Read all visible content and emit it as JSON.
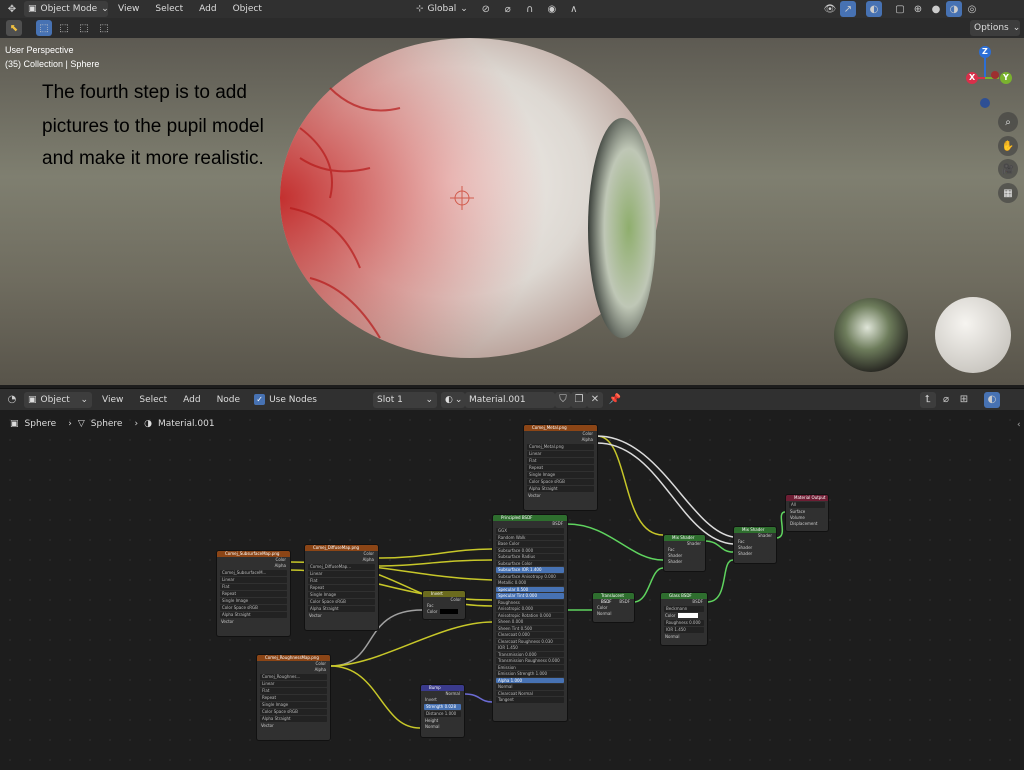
{
  "top_header": {
    "mode": "Object Mode",
    "menus": [
      "View",
      "Select",
      "Add",
      "Object"
    ],
    "orientation": "Global",
    "options_label": "Options"
  },
  "viewport": {
    "perspective": "User Perspective",
    "collection": "(35) Collection | Sphere",
    "annotation": [
      "The fourth step is to add",
      "pictures to the pupil model",
      "and make it more realistic."
    ],
    "gizmo": {
      "z": "Z",
      "x": "X",
      "y": "Y"
    }
  },
  "node_header": {
    "object": "Object",
    "menus": [
      "View",
      "Select",
      "Add",
      "Node"
    ],
    "use_nodes_label": "Use Nodes",
    "use_nodes_checked": true,
    "slot": "Slot 1",
    "material": "Material.001"
  },
  "breadcrumb": {
    "items": [
      "Sphere",
      "Sphere",
      "Material.001"
    ]
  },
  "nodes": {
    "tex_metal": {
      "title": "Comej_Metal.png",
      "outputs": [
        "Color",
        "Alpha"
      ],
      "image": "Comej_Metal.png",
      "rows": [
        "Linear",
        "Flat",
        "Repeat",
        "Single Image",
        "Color Space   sRGB",
        "Alpha   Straight"
      ],
      "inputs": [
        "Vector"
      ]
    },
    "tex_subsurface": {
      "title": "Comej_SubsurfaceMap.png",
      "outputs": [
        "Color",
        "Alpha"
      ],
      "image": "Comej_SubsurfaceM...",
      "rows": [
        "Linear",
        "Flat",
        "Repeat",
        "Single Image",
        "Color Space   sRGB",
        "Alpha   Straight"
      ],
      "inputs": [
        "Vector"
      ]
    },
    "tex_diffuse": {
      "title": "Comej_DiffuseMap.png",
      "outputs": [
        "Color",
        "Alpha"
      ],
      "image": "Comej_DiffuseMap...",
      "rows": [
        "Linear",
        "Flat",
        "Repeat",
        "Single Image",
        "Color Space   sRGB",
        "Alpha   Straight"
      ],
      "inputs": [
        "Vector"
      ]
    },
    "tex_roughness": {
      "title": "Comej_RoughnessMap.png",
      "outputs": [
        "Color",
        "Alpha"
      ],
      "image": "Comej_Roughnes...",
      "rows": [
        "Linear",
        "Flat",
        "Repeat",
        "Single Image",
        "Color Space   sRGB",
        "Alpha   Straight"
      ],
      "inputs": [
        "Vector"
      ]
    },
    "invert": {
      "title": "Invert",
      "outputs": [
        "Color"
      ],
      "inputs": [
        "Fac",
        "Color"
      ]
    },
    "bump": {
      "title": "Bump",
      "outputs": [
        "Normal"
      ],
      "inputs": [
        "Invert",
        "Strength  0.028",
        "Distance  1.000",
        "Height",
        "Normal"
      ]
    },
    "principled": {
      "title": "Principled BSDF",
      "outputs": [
        "BSDF"
      ],
      "rows": [
        "GGX",
        "Random Walk",
        "Base Color",
        "Subsurface  0.000",
        "Subsurface Radius",
        "Subsurface Color",
        "Subsurface IOR  1.400",
        "Subsurface Anisotropy  0.000",
        "Metallic  0.000",
        "Specular  0.500",
        "Specular Tint  0.000",
        "Roughness",
        "Anisotropic  0.000",
        "Anisotropic Rotation  0.000",
        "Sheen  0.000",
        "Sheen Tint  0.500",
        "Clearcoat  0.000",
        "Clearcoat Roughness  0.030",
        "IOR  1.450",
        "Transmission  0.000",
        "Transmission Roughness  0.000",
        "Emission",
        "Emission Strength  1.000",
        "Alpha  1.000",
        "Normal",
        "Clearcoat Normal",
        "Tangent"
      ]
    },
    "translucent": {
      "title": "Translucent BSDF",
      "outputs": [
        "BSDF"
      ],
      "inputs": [
        "Color",
        "Normal"
      ]
    },
    "mix1": {
      "title": "Mix Shader",
      "outputs": [
        "Shader"
      ],
      "inputs": [
        "Fac",
        "Shader",
        "Shader"
      ]
    },
    "glass": {
      "title": "Glass BSDF",
      "outputs": [
        "BSDF"
      ],
      "rows": [
        "Beckmann",
        "Color",
        "Roughness  0.000",
        "IOR  1.450"
      ],
      "inputs": [
        "Normal"
      ]
    },
    "mix2": {
      "title": "Mix Shader",
      "outputs": [
        "Shader"
      ],
      "inputs": [
        "Fac",
        "Shader",
        "Shader"
      ]
    },
    "output": {
      "title": "Material Output",
      "rows": [
        "All"
      ],
      "inputs": [
        "Surface",
        "Volume",
        "Displacement"
      ]
    }
  },
  "colors": {
    "texture_header": "#8b4516",
    "shader_header": "#2e6e2e",
    "vector_header": "#3a3a8c",
    "color_header": "#6b6b1e",
    "output_header": "#6e1e34",
    "wire_color": "#c7c729",
    "wire_shader": "#5fd45f",
    "wire_gray": "#a0a0a0",
    "accent": "#4772b3"
  }
}
